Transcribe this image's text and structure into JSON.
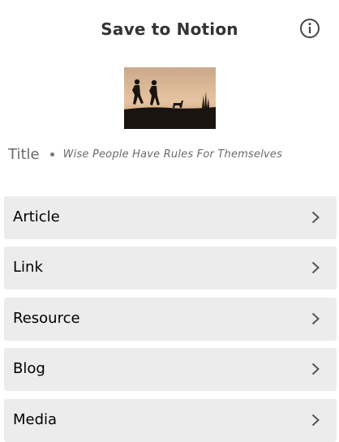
{
  "header": {
    "title": "Save to Notion",
    "info_icon": "info-circle-icon"
  },
  "preview": {
    "image_icon": "silhouette-runners-sunset-image"
  },
  "page_title": {
    "label": "Title",
    "value": "Wise People Have Rules For Themselves"
  },
  "destinations": [
    {
      "label": "Article",
      "icon": "chevron-right-icon"
    },
    {
      "label": "Link",
      "icon": "chevron-right-icon"
    },
    {
      "label": "Resource",
      "icon": "chevron-right-icon"
    },
    {
      "label": "Blog",
      "icon": "chevron-right-icon"
    },
    {
      "label": "Media",
      "icon": "chevron-right-icon"
    }
  ],
  "colors": {
    "item_background": "#ececec",
    "title_text": "#333333",
    "muted_text": "#6b6b6b"
  }
}
